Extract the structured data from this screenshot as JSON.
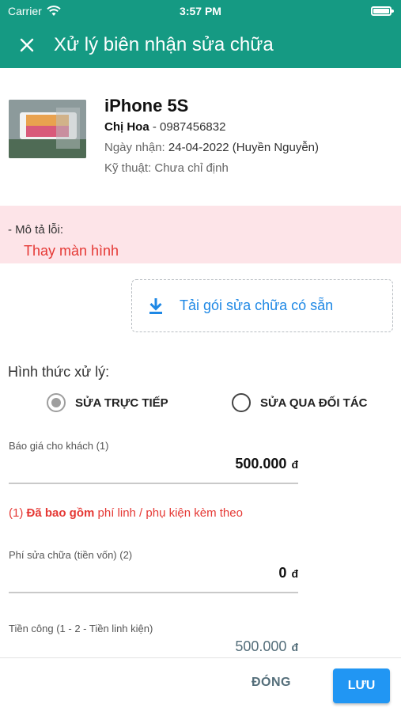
{
  "status_bar": {
    "carrier": "Carrier",
    "time": "3:57 PM"
  },
  "header": {
    "title": "Xử lý biên nhận sửa chữa",
    "close_icon": "close-icon"
  },
  "device": {
    "name": "iPhone 5S",
    "customer_name": "Chị Hoa",
    "customer_sep": " - ",
    "customer_phone": "0987456832",
    "received_label": "Ngày nhận:",
    "received_value": "24-04-2022 (Huyền Nguyễn)",
    "tech_label": "Kỹ thuật:",
    "tech_value": "Chưa chỉ định"
  },
  "fault": {
    "label": "- Mô tả lỗi:",
    "value": "Thay màn hình"
  },
  "load_package": {
    "label": "Tải gói sửa chữa có sẵn",
    "icon": "download-icon"
  },
  "method": {
    "label": "Hình thức xử lý:",
    "options": [
      {
        "label": "SỬA TRỰC TIẾP",
        "selected": true
      },
      {
        "label": "SỬA QUA ĐỐI TÁC",
        "selected": false
      }
    ]
  },
  "fields": {
    "quote": {
      "label": "Báo giá cho khách (1)",
      "value": "500.000",
      "currency": "đ"
    },
    "note_prefix": "(1) ",
    "note_bold": "Đã bao gồm",
    "note_rest": " phí linh / phụ kiện kèm theo",
    "repair_cost": {
      "label": "Phí sửa chữa (tiền vốn) (2)",
      "value": "0",
      "currency": "đ"
    },
    "labor": {
      "label": "Tiền công (1 - 2 - Tiền linh kiện)",
      "value": "500.000",
      "currency": "đ"
    }
  },
  "actions": {
    "close_label": "ĐÓNG",
    "save_label": "LƯU"
  },
  "colors": {
    "primary": "#159a83",
    "accent_blue": "#2196f3",
    "error_red": "#e53935",
    "fault_bg": "#fde4e8"
  }
}
